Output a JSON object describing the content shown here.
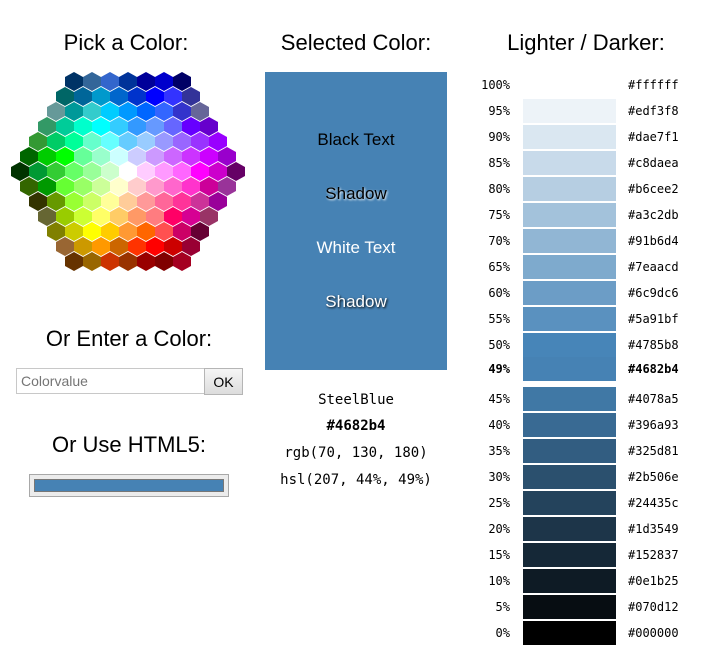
{
  "left": {
    "pick_title": "Pick a Color:",
    "enter_title": "Or Enter a Color:",
    "input_placeholder": "Colorvalue",
    "ok_label": "OK",
    "html5_title": "Or Use HTML5:",
    "html5_value": "#4682b4"
  },
  "hex_colors": [
    [
      "#003366",
      "#336699",
      "#3366cc",
      "#003399",
      "#000099",
      "#0000cc",
      "#000066"
    ],
    [
      "#006666",
      "#006699",
      "#0099cc",
      "#0066cc",
      "#0033cc",
      "#0000ff",
      "#3333ff",
      "#333399"
    ],
    [
      "#669999",
      "#009999",
      "#33cccc",
      "#00ccff",
      "#0099ff",
      "#0066ff",
      "#3366ff",
      "#3333cc",
      "#666699"
    ],
    [
      "#339966",
      "#00cc99",
      "#00ffcc",
      "#00ffff",
      "#33ccff",
      "#3399ff",
      "#6699ff",
      "#6666ff",
      "#6600ff",
      "#6600cc"
    ],
    [
      "#339933",
      "#00cc66",
      "#00ff99",
      "#66ffcc",
      "#66ffff",
      "#66ccff",
      "#99ccff",
      "#9999ff",
      "#9966ff",
      "#9933ff",
      "#9900ff"
    ],
    [
      "#006600",
      "#00cc00",
      "#00ff00",
      "#66ff99",
      "#99ffcc",
      "#ccffff",
      "#ccccff",
      "#cc99ff",
      "#cc66ff",
      "#cc33ff",
      "#cc00ff",
      "#9900cc"
    ],
    [
      "#003300",
      "#009933",
      "#33cc33",
      "#66ff66",
      "#99ff99",
      "#ccffcc",
      "#ffffff",
      "#ffccff",
      "#ff99ff",
      "#ff66ff",
      "#ff00ff",
      "#cc00cc",
      "#660066"
    ],
    [
      "#336600",
      "#009900",
      "#66ff33",
      "#99ff66",
      "#ccff99",
      "#ffffcc",
      "#ffcccc",
      "#ff99cc",
      "#ff66cc",
      "#ff33cc",
      "#cc0099",
      "#993399"
    ],
    [
      "#333300",
      "#669900",
      "#99ff33",
      "#ccff66",
      "#ffff99",
      "#ffcc99",
      "#ff9999",
      "#ff6699",
      "#ff3399",
      "#cc3399",
      "#990099"
    ],
    [
      "#666633",
      "#99cc00",
      "#ccff33",
      "#ffff66",
      "#ffcc66",
      "#ff9966",
      "#ff7c80",
      "#ff0066",
      "#d60093",
      "#993366"
    ],
    [
      "#808000",
      "#cccc00",
      "#ffff00",
      "#ffcc00",
      "#ff9933",
      "#ff6600",
      "#ff5050",
      "#cc0066",
      "#660033"
    ],
    [
      "#996633",
      "#cc9900",
      "#ff9900",
      "#cc6600",
      "#ff3300",
      "#ff0000",
      "#cc0000",
      "#990033"
    ],
    [
      "#663300",
      "#996600",
      "#cc3300",
      "#993300",
      "#990000",
      "#800000",
      "#a50021"
    ]
  ],
  "selected": {
    "title": "Selected Color:",
    "color": "#4682b4",
    "black_text": "Black Text",
    "shadow_dark": "Shadow",
    "white_text": "White Text",
    "shadow_light": "Shadow",
    "name": "SteelBlue",
    "hex": "#4682b4",
    "rgb": "rgb(70, 130, 180)",
    "hsl": "hsl(207, 44%, 49%)"
  },
  "lighter_darker": {
    "title": "Lighter / Darker:",
    "rows": [
      {
        "pct": "100%",
        "hex": "#ffffff"
      },
      {
        "pct": "95%",
        "hex": "#edf3f8"
      },
      {
        "pct": "90%",
        "hex": "#dae7f1"
      },
      {
        "pct": "85%",
        "hex": "#c8daea"
      },
      {
        "pct": "80%",
        "hex": "#b6cee2"
      },
      {
        "pct": "75%",
        "hex": "#a3c2db"
      },
      {
        "pct": "70%",
        "hex": "#91b6d4"
      },
      {
        "pct": "65%",
        "hex": "#7eaacd"
      },
      {
        "pct": "60%",
        "hex": "#6c9dc6"
      },
      {
        "pct": "55%",
        "hex": "#5a91bf"
      },
      {
        "pct": "50%",
        "hex": "#4785b8"
      },
      {
        "pct": "49%",
        "hex": "#4682b4",
        "current": true
      },
      {
        "pct": "45%",
        "hex": "#4078a5"
      },
      {
        "pct": "40%",
        "hex": "#396a93"
      },
      {
        "pct": "35%",
        "hex": "#325d81"
      },
      {
        "pct": "30%",
        "hex": "#2b506e"
      },
      {
        "pct": "25%",
        "hex": "#24435c"
      },
      {
        "pct": "20%",
        "hex": "#1d3549"
      },
      {
        "pct": "15%",
        "hex": "#152837"
      },
      {
        "pct": "10%",
        "hex": "#0e1b25"
      },
      {
        "pct": "5%",
        "hex": "#070d12"
      },
      {
        "pct": "0%",
        "hex": "#000000"
      }
    ]
  }
}
